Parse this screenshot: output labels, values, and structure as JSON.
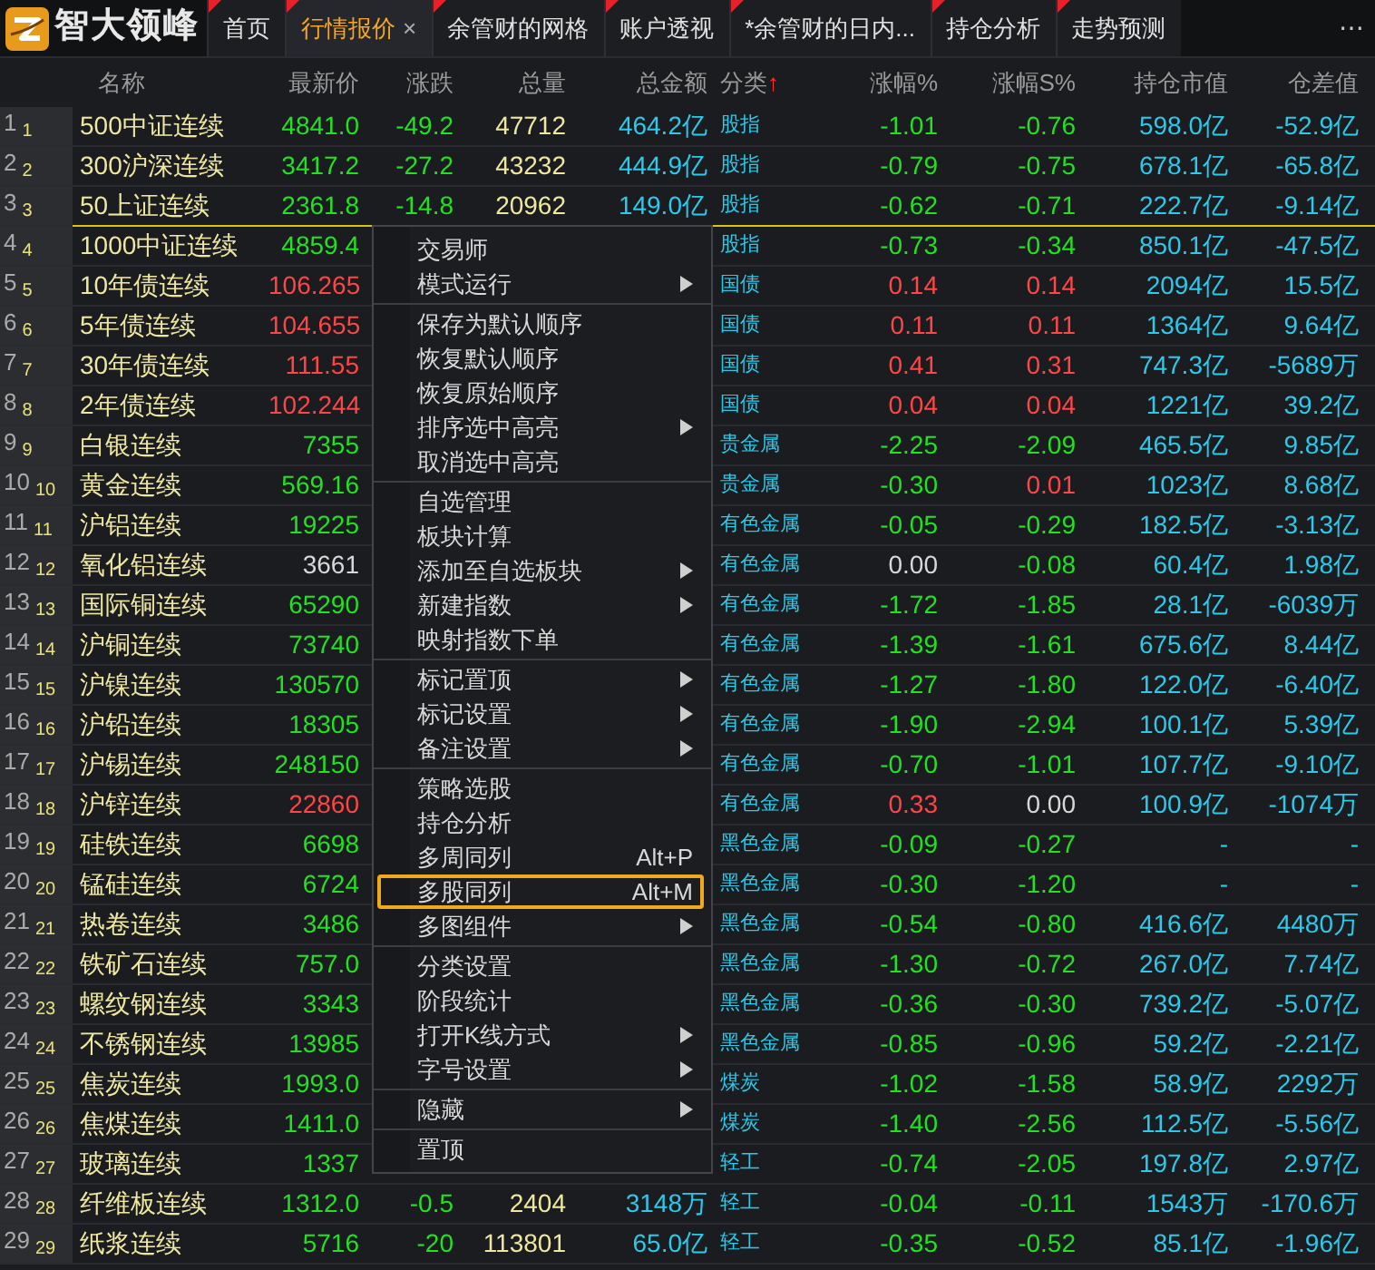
{
  "app": {
    "logo_text": "智大领峰"
  },
  "tabs": [
    {
      "label": "首页",
      "selected": false,
      "flagged": true
    },
    {
      "label": "行情报价",
      "selected": true,
      "flagged": true,
      "close": "×"
    },
    {
      "label": "余管财的网格",
      "selected": false,
      "flagged": true
    },
    {
      "label": "账户透视",
      "selected": false,
      "flagged": true
    },
    {
      "label": "*余管财的日内...",
      "selected": false,
      "flagged": true
    },
    {
      "label": "持仓分析",
      "selected": false,
      "flagged": true
    },
    {
      "label": "走势预测",
      "selected": false,
      "flagged": true
    }
  ],
  "tab_overflow": "⋯",
  "table": {
    "columns": [
      {
        "label": "名称"
      },
      {
        "label": "最新价"
      },
      {
        "label": "涨跌"
      },
      {
        "label": "总量"
      },
      {
        "label": "总金额"
      },
      {
        "label": "分类",
        "sort_arrow": "↑"
      },
      {
        "label": "涨幅%"
      },
      {
        "label": "涨幅S%"
      },
      {
        "label": "持仓市值"
      },
      {
        "label": "仓差值"
      }
    ],
    "rows": [
      {
        "num": "1",
        "sub": "1",
        "selected": false,
        "name": "500中证连续",
        "price": {
          "text": "4841.0",
          "color": "#22e022"
        },
        "change": {
          "text": "-49.2",
          "color": "#22e022"
        },
        "volume": "47712",
        "amount": "464.2亿",
        "category": "股指",
        "pct": {
          "text": "-1.01",
          "color": "#22e022"
        },
        "pct_s": {
          "text": "-0.76",
          "color": "#22e022"
        },
        "oi_value": "598.0亿",
        "oi_diff": "-52.9亿"
      },
      {
        "num": "2",
        "sub": "2",
        "selected": false,
        "name": "300沪深连续",
        "price": {
          "text": "3417.2",
          "color": "#22e022"
        },
        "change": {
          "text": "-27.2",
          "color": "#22e022"
        },
        "volume": "43232",
        "amount": "444.9亿",
        "category": "股指",
        "pct": {
          "text": "-0.79",
          "color": "#22e022"
        },
        "pct_s": {
          "text": "-0.75",
          "color": "#22e022"
        },
        "oi_value": "678.1亿",
        "oi_diff": "-65.8亿"
      },
      {
        "num": "3",
        "sub": "3",
        "selected": true,
        "name": "50上证连续",
        "price": {
          "text": "2361.8",
          "color": "#22e022"
        },
        "change": {
          "text": "-14.8",
          "color": "#22e022"
        },
        "volume": "20962",
        "amount": "149.0亿",
        "category": "股指",
        "pct": {
          "text": "-0.62",
          "color": "#22e022"
        },
        "pct_s": {
          "text": "-0.71",
          "color": "#22e022"
        },
        "oi_value": "222.7亿",
        "oi_diff": "-9.14亿"
      },
      {
        "num": "4",
        "sub": "4",
        "selected": false,
        "name": "1000中证连续",
        "price": {
          "text": "4859.4",
          "color": "#22e022"
        },
        "category": "股指",
        "pct": {
          "text": "-0.73",
          "color": "#22e022"
        },
        "pct_s": {
          "text": "-0.34",
          "color": "#22e022"
        },
        "oi_value": "850.1亿",
        "oi_diff": "-47.5亿"
      },
      {
        "num": "5",
        "sub": "5",
        "selected": false,
        "name": "10年债连续",
        "price": {
          "text": "106.265",
          "color": "#ff4545"
        },
        "category": "国债",
        "pct": {
          "text": "0.14",
          "color": "#ff4545"
        },
        "pct_s": {
          "text": "0.14",
          "color": "#ff4545"
        },
        "oi_value": "2094亿",
        "oi_diff": "15.5亿"
      },
      {
        "num": "6",
        "sub": "6",
        "selected": false,
        "name": "5年债连续",
        "price": {
          "text": "104.655",
          "color": "#ff4545"
        },
        "category": "国债",
        "pct": {
          "text": "0.11",
          "color": "#ff4545"
        },
        "pct_s": {
          "text": "0.11",
          "color": "#ff4545"
        },
        "oi_value": "1364亿",
        "oi_diff": "9.64亿"
      },
      {
        "num": "7",
        "sub": "7",
        "selected": false,
        "name": "30年债连续",
        "price": {
          "text": "111.55",
          "color": "#ff4545"
        },
        "category": "国债",
        "pct": {
          "text": "0.41",
          "color": "#ff4545"
        },
        "pct_s": {
          "text": "0.31",
          "color": "#ff4545"
        },
        "oi_value": "747.3亿",
        "oi_diff": "-5689万"
      },
      {
        "num": "8",
        "sub": "8",
        "selected": false,
        "name": "2年债连续",
        "price": {
          "text": "102.244",
          "color": "#ff4545"
        },
        "category": "国债",
        "pct": {
          "text": "0.04",
          "color": "#ff4545"
        },
        "pct_s": {
          "text": "0.04",
          "color": "#ff4545"
        },
        "oi_value": "1221亿",
        "oi_diff": "39.2亿"
      },
      {
        "num": "9",
        "sub": "9",
        "selected": false,
        "name": "白银连续",
        "price": {
          "text": "7355",
          "color": "#22e022"
        },
        "category": "贵金属",
        "pct": {
          "text": "-2.25",
          "color": "#22e022"
        },
        "pct_s": {
          "text": "-2.09",
          "color": "#22e022"
        },
        "oi_value": "465.5亿",
        "oi_diff": "9.85亿"
      },
      {
        "num": "10",
        "sub": "10",
        "selected": false,
        "name": "黄金连续",
        "price": {
          "text": "569.16",
          "color": "#22e022"
        },
        "category": "贵金属",
        "pct": {
          "text": "-0.30",
          "color": "#22e022"
        },
        "pct_s": {
          "text": "0.01",
          "color": "#ff4545"
        },
        "oi_value": "1023亿",
        "oi_diff": "8.68亿"
      },
      {
        "num": "11",
        "sub": "11",
        "selected": false,
        "name": "沪铝连续",
        "price": {
          "text": "19225",
          "color": "#22e022"
        },
        "category": "有色金属",
        "pct": {
          "text": "-0.05",
          "color": "#22e022"
        },
        "pct_s": {
          "text": "-0.29",
          "color": "#22e022"
        },
        "oi_value": "182.5亿",
        "oi_diff": "-3.13亿"
      },
      {
        "num": "12",
        "sub": "12",
        "selected": false,
        "name": "氧化铝连续",
        "price": {
          "text": "3661",
          "color": "#d8d8d8"
        },
        "category": "有色金属",
        "pct": {
          "text": "0.00",
          "color": "#d8d8d8"
        },
        "pct_s": {
          "text": "-0.08",
          "color": "#22e022"
        },
        "oi_value": "60.4亿",
        "oi_diff": "1.98亿"
      },
      {
        "num": "13",
        "sub": "13",
        "selected": false,
        "name": "国际铜连续",
        "price": {
          "text": "65290",
          "color": "#22e022"
        },
        "category": "有色金属",
        "pct": {
          "text": "-1.72",
          "color": "#22e022"
        },
        "pct_s": {
          "text": "-1.85",
          "color": "#22e022"
        },
        "oi_value": "28.1亿",
        "oi_diff": "-6039万"
      },
      {
        "num": "14",
        "sub": "14",
        "selected": false,
        "name": "沪铜连续",
        "price": {
          "text": "73740",
          "color": "#22e022"
        },
        "category": "有色金属",
        "pct": {
          "text": "-1.39",
          "color": "#22e022"
        },
        "pct_s": {
          "text": "-1.61",
          "color": "#22e022"
        },
        "oi_value": "675.6亿",
        "oi_diff": "8.44亿"
      },
      {
        "num": "15",
        "sub": "15",
        "selected": false,
        "name": "沪镍连续",
        "price": {
          "text": "130570",
          "color": "#22e022"
        },
        "category": "有色金属",
        "pct": {
          "text": "-1.27",
          "color": "#22e022"
        },
        "pct_s": {
          "text": "-1.80",
          "color": "#22e022"
        },
        "oi_value": "122.0亿",
        "oi_diff": "-6.40亿"
      },
      {
        "num": "16",
        "sub": "16",
        "selected": false,
        "name": "沪铅连续",
        "price": {
          "text": "18305",
          "color": "#22e022"
        },
        "category": "有色金属",
        "pct": {
          "text": "-1.90",
          "color": "#22e022"
        },
        "pct_s": {
          "text": "-2.94",
          "color": "#22e022"
        },
        "oi_value": "100.1亿",
        "oi_diff": "5.39亿"
      },
      {
        "num": "17",
        "sub": "17",
        "selected": false,
        "name": "沪锡连续",
        "price": {
          "text": "248150",
          "color": "#22e022"
        },
        "category": "有色金属",
        "pct": {
          "text": "-0.70",
          "color": "#22e022"
        },
        "pct_s": {
          "text": "-1.01",
          "color": "#22e022"
        },
        "oi_value": "107.7亿",
        "oi_diff": "-9.10亿"
      },
      {
        "num": "18",
        "sub": "18",
        "selected": false,
        "name": "沪锌连续",
        "price": {
          "text": "22860",
          "color": "#ff4545"
        },
        "category": "有色金属",
        "pct": {
          "text": "0.33",
          "color": "#ff4545"
        },
        "pct_s": {
          "text": "0.00",
          "color": "#d8d8d8"
        },
        "oi_value": "100.9亿",
        "oi_diff": "-1074万"
      },
      {
        "num": "19",
        "sub": "19",
        "selected": false,
        "name": "硅铁连续",
        "price": {
          "text": "6698",
          "color": "#22e022"
        },
        "category": "黑色金属",
        "pct": {
          "text": "-0.09",
          "color": "#22e022"
        },
        "pct_s": {
          "text": "-0.27",
          "color": "#22e022"
        },
        "oi_value": "-",
        "oi_diff": "-"
      },
      {
        "num": "20",
        "sub": "20",
        "selected": false,
        "name": "锰硅连续",
        "price": {
          "text": "6724",
          "color": "#22e022"
        },
        "category": "黑色金属",
        "pct": {
          "text": "-0.30",
          "color": "#22e022"
        },
        "pct_s": {
          "text": "-1.20",
          "color": "#22e022"
        },
        "oi_value": "-",
        "oi_diff": "-"
      },
      {
        "num": "21",
        "sub": "21",
        "selected": false,
        "name": "热卷连续",
        "price": {
          "text": "3486",
          "color": "#22e022"
        },
        "category": "黑色金属",
        "pct": {
          "text": "-0.54",
          "color": "#22e022"
        },
        "pct_s": {
          "text": "-0.80",
          "color": "#22e022"
        },
        "oi_value": "416.6亿",
        "oi_diff": "4480万"
      },
      {
        "num": "22",
        "sub": "22",
        "selected": false,
        "name": "铁矿石连续",
        "price": {
          "text": "757.0",
          "color": "#22e022"
        },
        "category": "黑色金属",
        "pct": {
          "text": "-1.30",
          "color": "#22e022"
        },
        "pct_s": {
          "text": "-0.72",
          "color": "#22e022"
        },
        "oi_value": "267.0亿",
        "oi_diff": "7.74亿"
      },
      {
        "num": "23",
        "sub": "23",
        "selected": false,
        "name": "螺纹钢连续",
        "price": {
          "text": "3343",
          "color": "#22e022"
        },
        "category": "黑色金属",
        "pct": {
          "text": "-0.36",
          "color": "#22e022"
        },
        "pct_s": {
          "text": "-0.30",
          "color": "#22e022"
        },
        "oi_value": "739.2亿",
        "oi_diff": "-5.07亿"
      },
      {
        "num": "24",
        "sub": "24",
        "selected": false,
        "name": "不锈钢连续",
        "price": {
          "text": "13985",
          "color": "#22e022"
        },
        "category": "黑色金属",
        "pct": {
          "text": "-0.85",
          "color": "#22e022"
        },
        "pct_s": {
          "text": "-0.96",
          "color": "#22e022"
        },
        "oi_value": "59.2亿",
        "oi_diff": "-2.21亿"
      },
      {
        "num": "25",
        "sub": "25",
        "selected": false,
        "name": "焦炭连续",
        "price": {
          "text": "1993.0",
          "color": "#22e022"
        },
        "category": "煤炭",
        "pct": {
          "text": "-1.02",
          "color": "#22e022"
        },
        "pct_s": {
          "text": "-1.58",
          "color": "#22e022"
        },
        "oi_value": "58.9亿",
        "oi_diff": "2292万"
      },
      {
        "num": "26",
        "sub": "26",
        "selected": false,
        "name": "焦煤连续",
        "price": {
          "text": "1411.0",
          "color": "#22e022"
        },
        "category": "煤炭",
        "pct": {
          "text": "-1.40",
          "color": "#22e022"
        },
        "pct_s": {
          "text": "-2.56",
          "color": "#22e022"
        },
        "oi_value": "112.5亿",
        "oi_diff": "-5.56亿"
      },
      {
        "num": "27",
        "sub": "27",
        "selected": false,
        "name": "玻璃连续",
        "price": {
          "text": "1337",
          "color": "#22e022"
        },
        "category": "轻工",
        "pct": {
          "text": "-0.74",
          "color": "#22e022"
        },
        "pct_s": {
          "text": "-2.05",
          "color": "#22e022"
        },
        "oi_value": "197.8亿",
        "oi_diff": "2.97亿"
      },
      {
        "num": "28",
        "sub": "28",
        "selected": false,
        "name": "纤维板连续",
        "price": {
          "text": "1312.0",
          "color": "#22e022"
        },
        "change": {
          "text": "-0.5",
          "color": "#22e022"
        },
        "volume": "2404",
        "amount": "3148万",
        "category": "轻工",
        "pct": {
          "text": "-0.04",
          "color": "#22e022"
        },
        "pct_s": {
          "text": "-0.11",
          "color": "#22e022"
        },
        "oi_value": "1543万",
        "oi_diff": "-170.6万"
      },
      {
        "num": "29",
        "sub": "29",
        "selected": false,
        "name": "纸浆连续",
        "price": {
          "text": "5716",
          "color": "#22e022"
        },
        "change": {
          "text": "-20",
          "color": "#22e022"
        },
        "volume": "113801",
        "amount": "65.0亿",
        "category": "轻工",
        "pct": {
          "text": "-0.35",
          "color": "#22e022"
        },
        "pct_s": {
          "text": "-0.52",
          "color": "#22e022"
        },
        "oi_value": "85.1亿",
        "oi_diff": "-1.96亿"
      }
    ]
  },
  "context_menu": {
    "groups": [
      [
        {
          "label": "交易师",
          "submenu": false,
          "selected": false
        },
        {
          "label": "模式运行",
          "submenu": true,
          "selected": false
        }
      ],
      [
        {
          "label": "保存为默认顺序",
          "submenu": false,
          "selected": false
        },
        {
          "label": "恢复默认顺序",
          "submenu": false,
          "selected": false
        },
        {
          "label": "恢复原始顺序",
          "submenu": false,
          "selected": false
        },
        {
          "label": "排序选中高亮",
          "submenu": true,
          "selected": false
        },
        {
          "label": "取消选中高亮",
          "submenu": false,
          "selected": false
        }
      ],
      [
        {
          "label": "自选管理",
          "submenu": false,
          "selected": false
        },
        {
          "label": "板块计算",
          "submenu": false,
          "selected": false
        },
        {
          "label": "添加至自选板块",
          "submenu": true,
          "selected": false
        },
        {
          "label": "新建指数",
          "submenu": true,
          "selected": false
        },
        {
          "label": "映射指数下单",
          "submenu": false,
          "selected": false
        }
      ],
      [
        {
          "label": "标记置顶",
          "submenu": true,
          "selected": false
        },
        {
          "label": "标记设置",
          "submenu": true,
          "selected": false
        },
        {
          "label": "备注设置",
          "submenu": true,
          "selected": false
        }
      ],
      [
        {
          "label": "策略选股",
          "submenu": false,
          "selected": false
        },
        {
          "label": "持仓分析",
          "submenu": false,
          "selected": false
        },
        {
          "label": "多周同列",
          "submenu": false,
          "selected": false,
          "shortcut": "Alt+P"
        },
        {
          "label": "多股同列",
          "submenu": false,
          "selected": true,
          "shortcut": "Alt+M"
        },
        {
          "label": "多图组件",
          "submenu": true,
          "selected": false
        }
      ],
      [
        {
          "label": "分类设置",
          "submenu": false,
          "selected": false
        },
        {
          "label": "阶段统计",
          "submenu": false,
          "selected": false
        },
        {
          "label": "打开K线方式",
          "submenu": true,
          "selected": false
        },
        {
          "label": "字号设置",
          "submenu": true,
          "selected": false
        }
      ],
      [
        {
          "label": "隐藏",
          "submenu": true,
          "selected": false
        }
      ],
      [
        {
          "label": "置顶",
          "submenu": false,
          "selected": false
        }
      ]
    ]
  }
}
